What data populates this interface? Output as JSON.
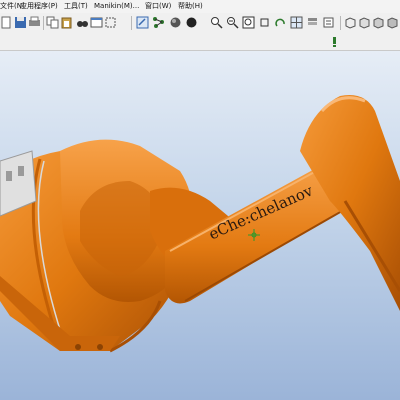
{
  "menu": {
    "items": [
      {
        "label": "文件(N)"
      },
      {
        "label": "应用程序(P)"
      },
      {
        "label": "工具(T)"
      },
      {
        "label": "Manikin(M)..."
      },
      {
        "label": "窗口(W)"
      },
      {
        "label": "帮助(H)"
      }
    ]
  },
  "toolbar": {
    "icons": [
      "new-icon",
      "save-icon",
      "print-icon",
      "copy-icon",
      "paste-icon",
      "binoculars-icon",
      "window-icon",
      "select-icon",
      "snap-icon",
      "network-icon",
      "sphere-icon",
      "zoom-icon",
      "zoom-fit-icon",
      "zoom-window-icon",
      "spin-icon",
      "multiview-icon",
      "layer-icon",
      "settings-icon",
      "view-front-icon",
      "view-top-icon",
      "view-side-icon",
      "view-iso-icon"
    ]
  },
  "viewport": {
    "watermark": "eChe:chelanov"
  },
  "colors": {
    "robot_orange": "#e0780f",
    "robot_shadow": "#b85a05",
    "robot_highlight": "#f59a3a",
    "background_top": "#e6edf6",
    "background_bottom": "#9bb4d8"
  }
}
